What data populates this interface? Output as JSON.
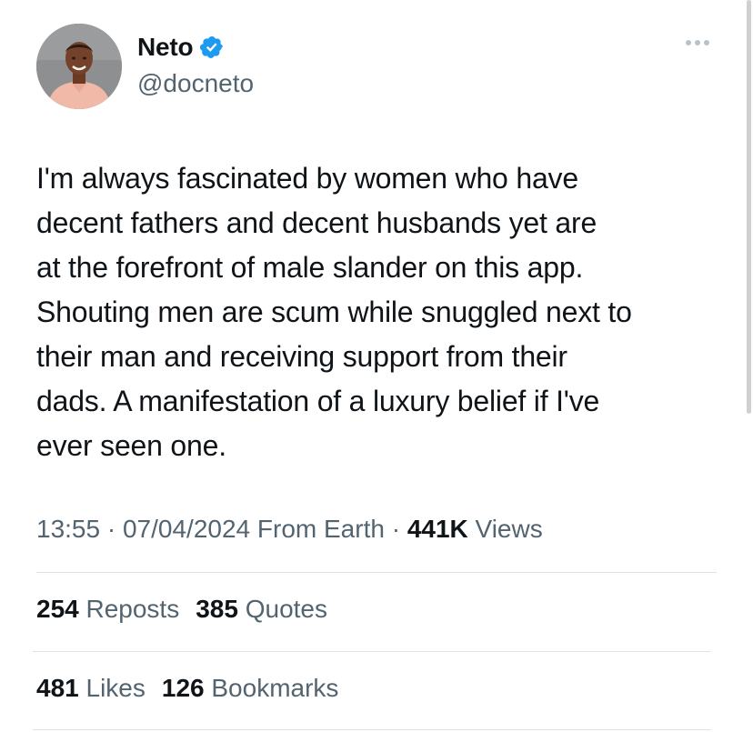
{
  "author": {
    "name": "Neto",
    "handle": "@docneto",
    "verified": true,
    "verified_color": "#1d9bf0"
  },
  "tweet": {
    "lines": [
      "I'm always fascinated by women who have",
      "decent fathers and decent husbands yet are",
      "at the forefront of male slander on this app.",
      "Shouting men are scum while snuggled next to",
      "their man and receiving support from their",
      "dads. A manifestation of a luxury belief if I've",
      "ever seen one."
    ]
  },
  "meta": {
    "time": "13:55",
    "sep1": " · ",
    "date": "07/04/2024",
    "source": " From Earth",
    "sep2": " · ",
    "views_count": "441K",
    "views_label": " Views"
  },
  "stats_row1": {
    "reposts_count": "254",
    "reposts_label": " Reposts",
    "quotes_count": "385",
    "quotes_label": " Quotes"
  },
  "stats_row2": {
    "likes_count": "481",
    "likes_label": " Likes",
    "bookmarks_count": "126",
    "bookmarks_label": " Bookmarks"
  },
  "icons": {
    "more": "more-horizontal-icon",
    "verified": "verified-badge-icon"
  },
  "colors": {
    "text": "#0f1419",
    "secondary": "#536471",
    "divider": "#dfe3e6"
  }
}
